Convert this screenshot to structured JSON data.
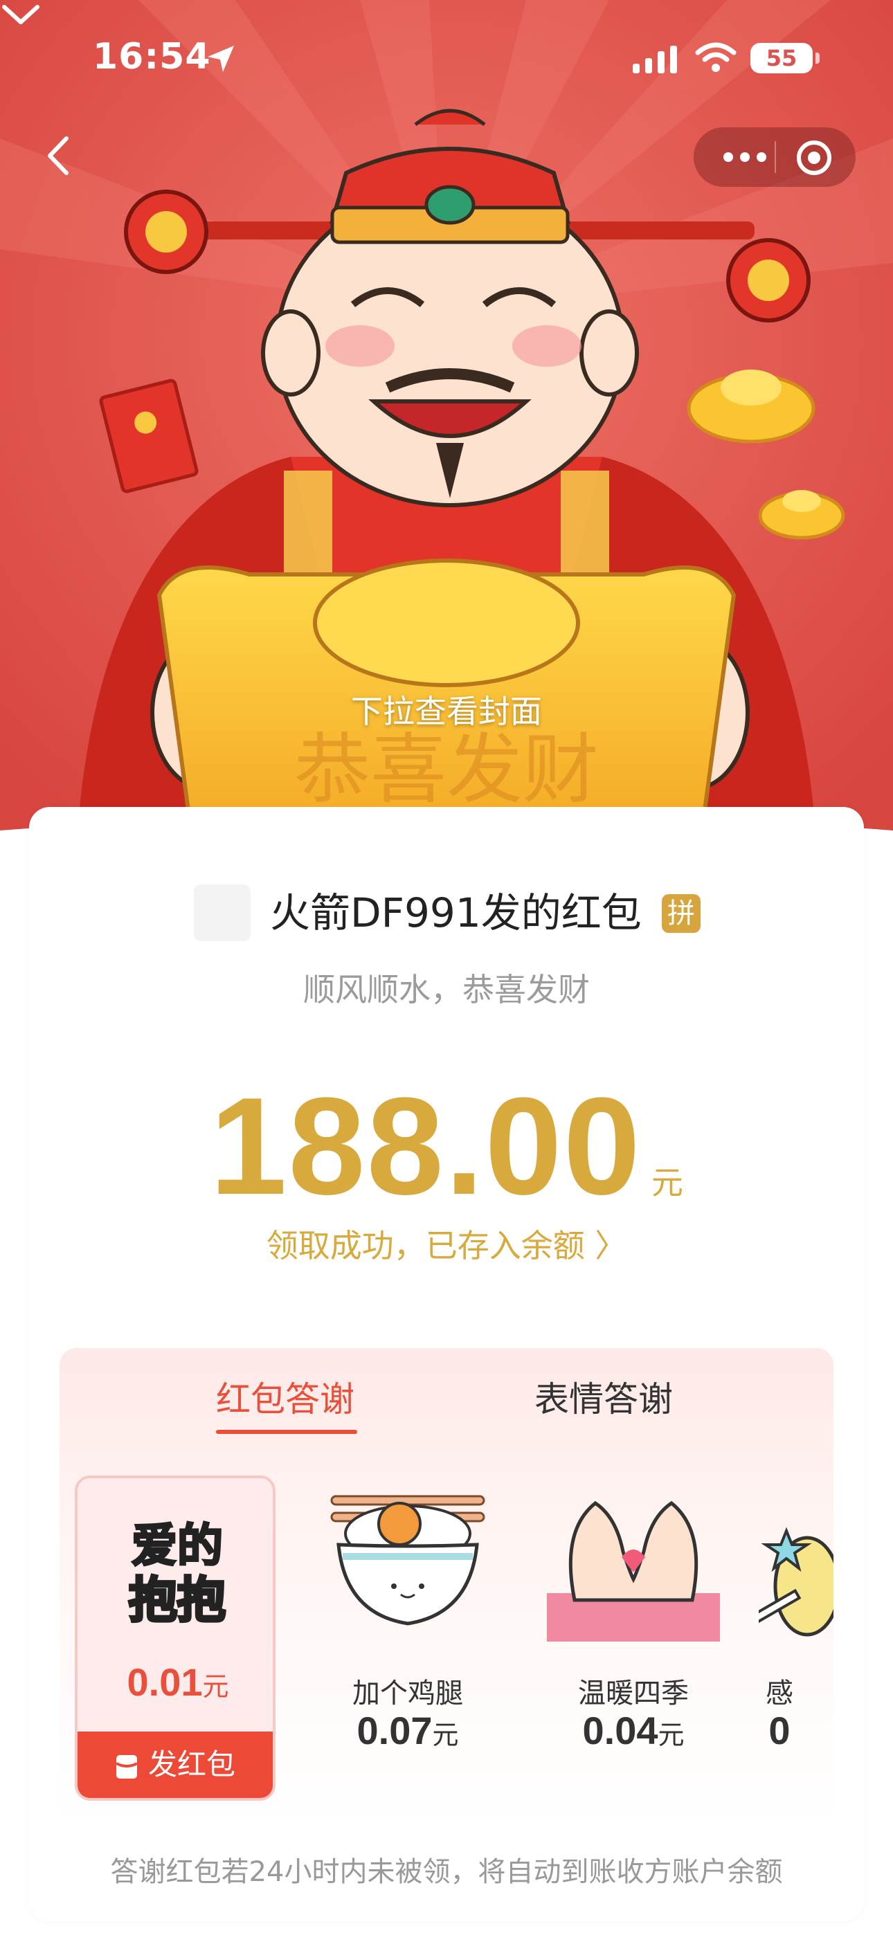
{
  "status_bar": {
    "time": "16:54",
    "battery": "55"
  },
  "nav": {
    "back": "back-icon",
    "more": "more-icon",
    "close": "close-icon"
  },
  "hero": {
    "pull_hint": "下拉查看封面"
  },
  "packet": {
    "sender": "火箭DF991发的红包",
    "badge": "拼",
    "greeting": "顺风顺水，恭喜发财",
    "amount": "188.00",
    "unit": "元",
    "status": "领取成功，已存入余额 〉"
  },
  "thanks": {
    "tabs": [
      {
        "label": "红包答谢"
      },
      {
        "label": "表情答谢"
      }
    ],
    "gifts": [
      {
        "name": "",
        "art_text": "爱的抱抱",
        "price": "0.01",
        "unit": "元",
        "selected": true
      },
      {
        "name": "加个鸡腿",
        "price": "0.07",
        "unit": "元"
      },
      {
        "name": "温暖四季",
        "price": "0.04",
        "unit": "元"
      },
      {
        "name": "感",
        "price": "0",
        "unit": ""
      }
    ],
    "send_label": "发红包",
    "footnote": "答谢红包若24小时内未被领，将自动到账收方账户余额"
  },
  "colors": {
    "accent": "#e9503b",
    "gold": "#d8a93d",
    "hero_red": "#e25a52"
  }
}
